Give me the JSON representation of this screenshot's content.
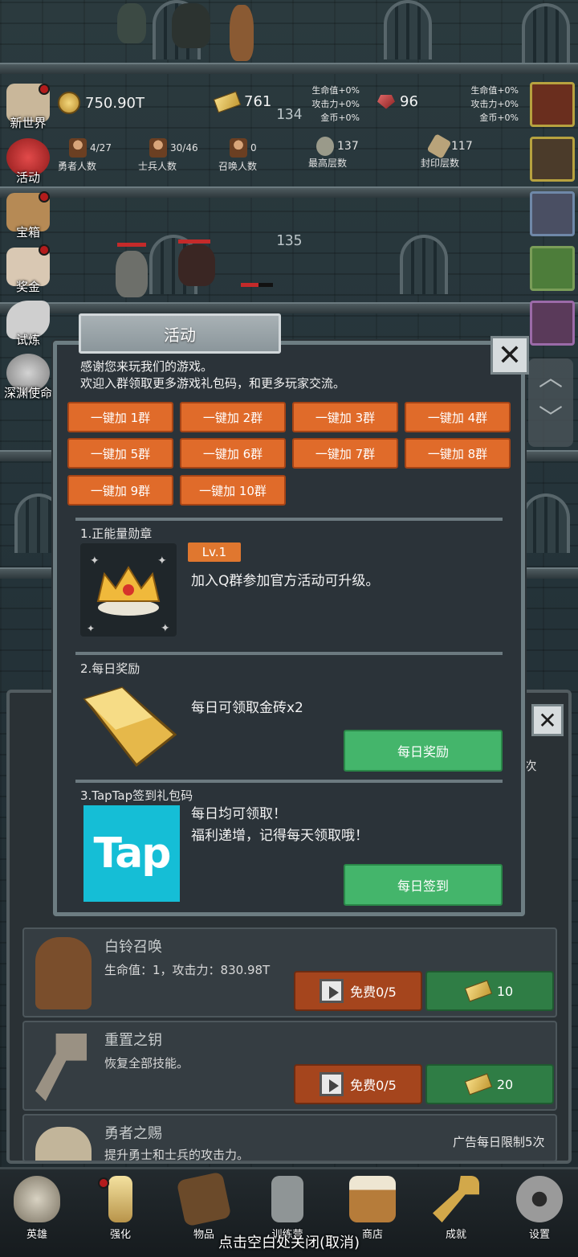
{
  "floors": {
    "floor_a": "134",
    "floor_b": "135"
  },
  "stats": {
    "gold": "750.90T",
    "gold_bars": "761",
    "gems": "96",
    "heroes": {
      "value": "4/27",
      "label": "勇者人数"
    },
    "soldiers": {
      "value": "30/46",
      "label": "士兵人数"
    },
    "summons": {
      "value": "0",
      "label": "召唤人数"
    },
    "highest_floor": {
      "value": "137",
      "label": "最高层数"
    },
    "sealed_floor": {
      "value": "117",
      "label": "封印层数"
    },
    "bonus_left": [
      "生命值+0%",
      "攻击力+0%",
      "金币+0%"
    ],
    "bonus_right": [
      "生命值+0%",
      "攻击力+0%",
      "金币+0%"
    ]
  },
  "side_menu": [
    {
      "label": "新世界"
    },
    {
      "label": "活动"
    },
    {
      "label": "宝箱"
    },
    {
      "label": "奖金"
    },
    {
      "label": "试炼"
    },
    {
      "label": "深渊使命"
    }
  ],
  "popup": {
    "title": "活动",
    "close_icon": "close-icon",
    "intro_line1": "感谢您来玩我们的游戏。",
    "intro_line2": "欢迎入群领取更多游戏礼包码，和更多玩家交流。",
    "group_buttons": [
      "一键加 1群",
      "一键加 2群",
      "一键加 3群",
      "一键加 4群",
      "一键加 5群",
      "一键加 6群",
      "一键加 7群",
      "一键加 8群",
      "一键加 9群",
      "一键加 10群"
    ],
    "section1": {
      "title": "1.正能量勋章",
      "level": "Lv.1",
      "text": "加入Q群参加官方活动可升级。"
    },
    "section2": {
      "title": "2.每日奖励",
      "text": "每日可领取金砖x2",
      "button": "每日奖励"
    },
    "section3": {
      "title": "3.TapTap签到礼包码",
      "line1": "每日均可领取！",
      "line2": "福利递增，记得每天领取哦！",
      "button": "每日签到",
      "logo_text": "Tap"
    }
  },
  "shop": {
    "partial_text": "5次",
    "rows": [
      {
        "title": "白铃召唤",
        "desc": "生命值：1，攻击力：830.98T",
        "ad_button": "免费0/5",
        "price": "10"
      },
      {
        "title": "重置之钥",
        "desc": "恢复全部技能。",
        "ad_button": "免费0/5",
        "price": "20"
      },
      {
        "title": "勇者之赐",
        "desc": "提升勇士和士兵的攻击力。",
        "limit": "广告每日限制5次"
      }
    ]
  },
  "navbar": [
    {
      "label": "英雄"
    },
    {
      "label": "强化"
    },
    {
      "label": "物品"
    },
    {
      "label": "训练营"
    },
    {
      "label": "商店"
    },
    {
      "label": "成就"
    },
    {
      "label": "设置"
    }
  ],
  "close_hint": "点击空白处关闭(取消)"
}
